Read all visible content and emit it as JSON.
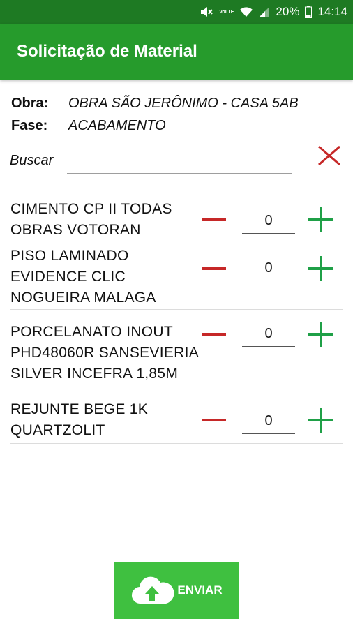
{
  "status_bar": {
    "volte": "VoLTE",
    "battery": "20%",
    "time": "14:14"
  },
  "app_bar": {
    "title": "Solicitação de Material"
  },
  "info": {
    "obra_label": "Obra:",
    "obra_value": "OBRA SÃO JERÔNIMO - CASA 5AB",
    "fase_label": "Fase:",
    "fase_value": "ACABAMENTO"
  },
  "search": {
    "label": "Buscar",
    "value": "",
    "placeholder": ""
  },
  "items": [
    {
      "name": "CIMENTO CP II TODAS OBRAS VOTORAN",
      "quantity": "0"
    },
    {
      "name": "PISO LAMINADO EVIDENCE CLIC NOGUEIRA MALAGA",
      "quantity": "0"
    },
    {
      "name": "PORCELANATO INOUT PHD48060R SANSEVIERIA SILVER INCEFRA 1,85M",
      "quantity": "0"
    },
    {
      "name": "REJUNTE BEGE 1K QUARTZOLIT",
      "quantity": "0"
    }
  ],
  "footer": {
    "send_label": "ENVIAR"
  },
  "colors": {
    "app_bar": "#269b2c",
    "status_bar": "#1e7a23",
    "minus": "#c62828",
    "plus": "#1fa047",
    "send_button": "#3fc040"
  },
  "icons": {
    "mute": "mute-icon",
    "wifi": "wifi-icon",
    "signal": "signal-icon",
    "battery": "battery-icon",
    "clear": "close-icon",
    "minus": "minus-icon",
    "plus": "plus-icon",
    "upload": "cloud-upload-icon"
  }
}
